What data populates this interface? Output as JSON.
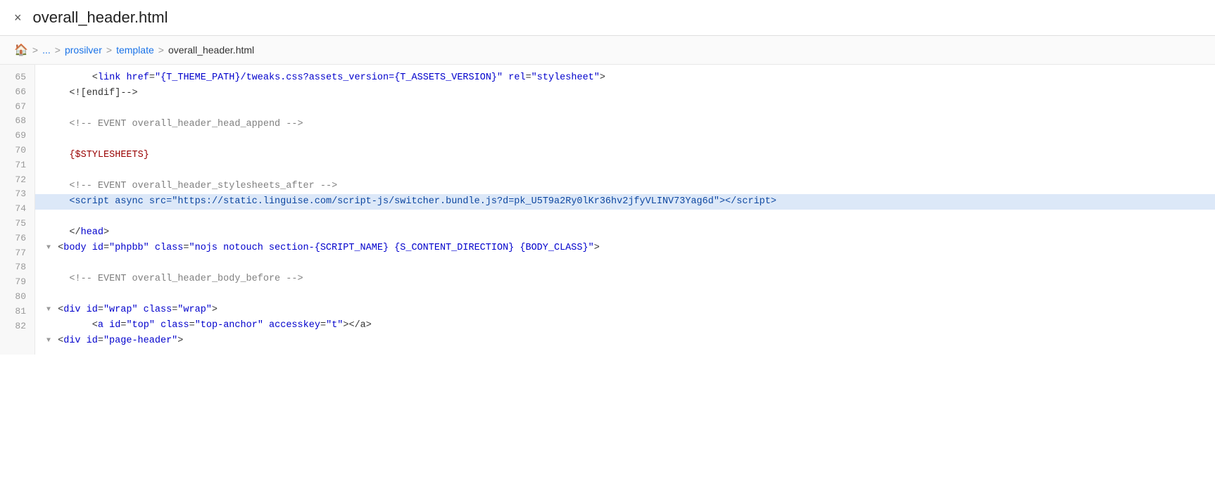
{
  "titleBar": {
    "closeLabel": "×",
    "title": "overall_header.html"
  },
  "breadcrumb": {
    "homeIcon": "🏠",
    "items": [
      "...",
      "prosilver",
      "template",
      "overall_header.html"
    ]
  },
  "lines": [
    {
      "num": 65,
      "indent": 2,
      "content": "<link href=\"{T_THEME_PATH}/tweaks.css?assets_version={T_ASSETS_VERSION}\" rel=\"stylesheet\">",
      "type": "code",
      "highlighted": false
    },
    {
      "num": 66,
      "indent": 1,
      "content": "<![endif]-->",
      "type": "code",
      "highlighted": false
    },
    {
      "num": 67,
      "indent": 0,
      "content": "",
      "type": "empty",
      "highlighted": false
    },
    {
      "num": 68,
      "indent": 1,
      "content": "<!-- EVENT overall_header_head_append -->",
      "type": "comment",
      "highlighted": false
    },
    {
      "num": 69,
      "indent": 0,
      "content": "",
      "type": "empty",
      "highlighted": false
    },
    {
      "num": 70,
      "indent": 1,
      "content": "{$STYLESHEETS}",
      "type": "template",
      "highlighted": false
    },
    {
      "num": 71,
      "indent": 0,
      "content": "",
      "type": "empty",
      "highlighted": false
    },
    {
      "num": 72,
      "indent": 1,
      "content": "<!-- EVENT overall_header_stylesheets_after -->",
      "type": "comment",
      "highlighted": false
    },
    {
      "num": 73,
      "indent": 1,
      "content": "<script async src=\"https://static.linguise.com/script-js/switcher.bundle.js?d=pk_U5T9a2Ry0lKr36hv2jfyVLINV73Yag6d\"><\\/script>",
      "type": "code",
      "highlighted": true
    },
    {
      "num": 74,
      "indent": 0,
      "content": "",
      "type": "empty",
      "highlighted": false
    },
    {
      "num": 75,
      "indent": 1,
      "content": "</head>",
      "type": "code",
      "highlighted": false
    },
    {
      "num": 76,
      "indent": 1,
      "content": "<body id=\"phpbb\" class=\"nojs notouch section-{SCRIPT_NAME} {S_CONTENT_DIRECTION} {BODY_CLASS}\">",
      "type": "code",
      "highlighted": false,
      "hasFold": true
    },
    {
      "num": 77,
      "indent": 0,
      "content": "",
      "type": "empty",
      "highlighted": false
    },
    {
      "num": 78,
      "indent": 1,
      "content": "<!-- EVENT overall_header_body_before -->",
      "type": "comment",
      "highlighted": false
    },
    {
      "num": 79,
      "indent": 0,
      "content": "",
      "type": "empty",
      "highlighted": false
    },
    {
      "num": 80,
      "indent": 1,
      "content": "<div id=\"wrap\" class=\"wrap\">",
      "type": "code",
      "highlighted": false,
      "hasFold": true
    },
    {
      "num": 81,
      "indent": 2,
      "content": "<a id=\"top\" class=\"top-anchor\" accesskey=\"t\"></a>",
      "type": "code",
      "highlighted": false
    },
    {
      "num": 82,
      "indent": 2,
      "content": "<div id=\"page-header\">",
      "type": "code",
      "highlighted": false,
      "hasFold": true
    }
  ],
  "colors": {
    "highlight": "#dce8f8",
    "lineNumBg": "#f8f8f8",
    "accent": "#1a73e8"
  }
}
